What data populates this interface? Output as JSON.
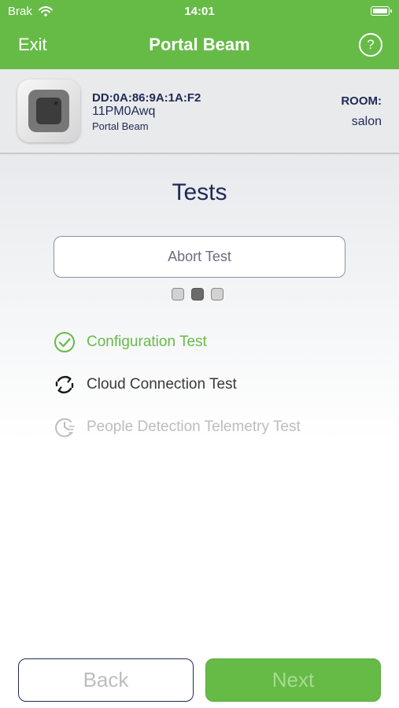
{
  "status": {
    "carrier": "Brak",
    "time": "14:01"
  },
  "nav": {
    "exit_label": "Exit",
    "title": "Portal Beam",
    "help_symbol": "?"
  },
  "device": {
    "mac": "DD:0A:86:9A:1A:F2",
    "serial": "11PM0Awq",
    "model": "Portal Beam",
    "room_label": "ROOM:",
    "room_value": "salon"
  },
  "main": {
    "heading": "Tests",
    "abort_label": "Abort Test",
    "progress": {
      "total_steps": 3,
      "current_step": 2
    },
    "tests": [
      {
        "label": "Configuration Test",
        "state": "done",
        "icon": "check-circle-icon"
      },
      {
        "label": "Cloud Connection Test",
        "state": "running",
        "icon": "refresh-icon"
      },
      {
        "label": "People Detection Telemetry Test",
        "state": "pending",
        "icon": "clock-icon"
      }
    ]
  },
  "footer": {
    "back_label": "Back",
    "next_label": "Next"
  },
  "colors": {
    "brand_green": "#66bb47",
    "navy": "#1f2a56",
    "pending_gray": "#bdbdbd"
  }
}
